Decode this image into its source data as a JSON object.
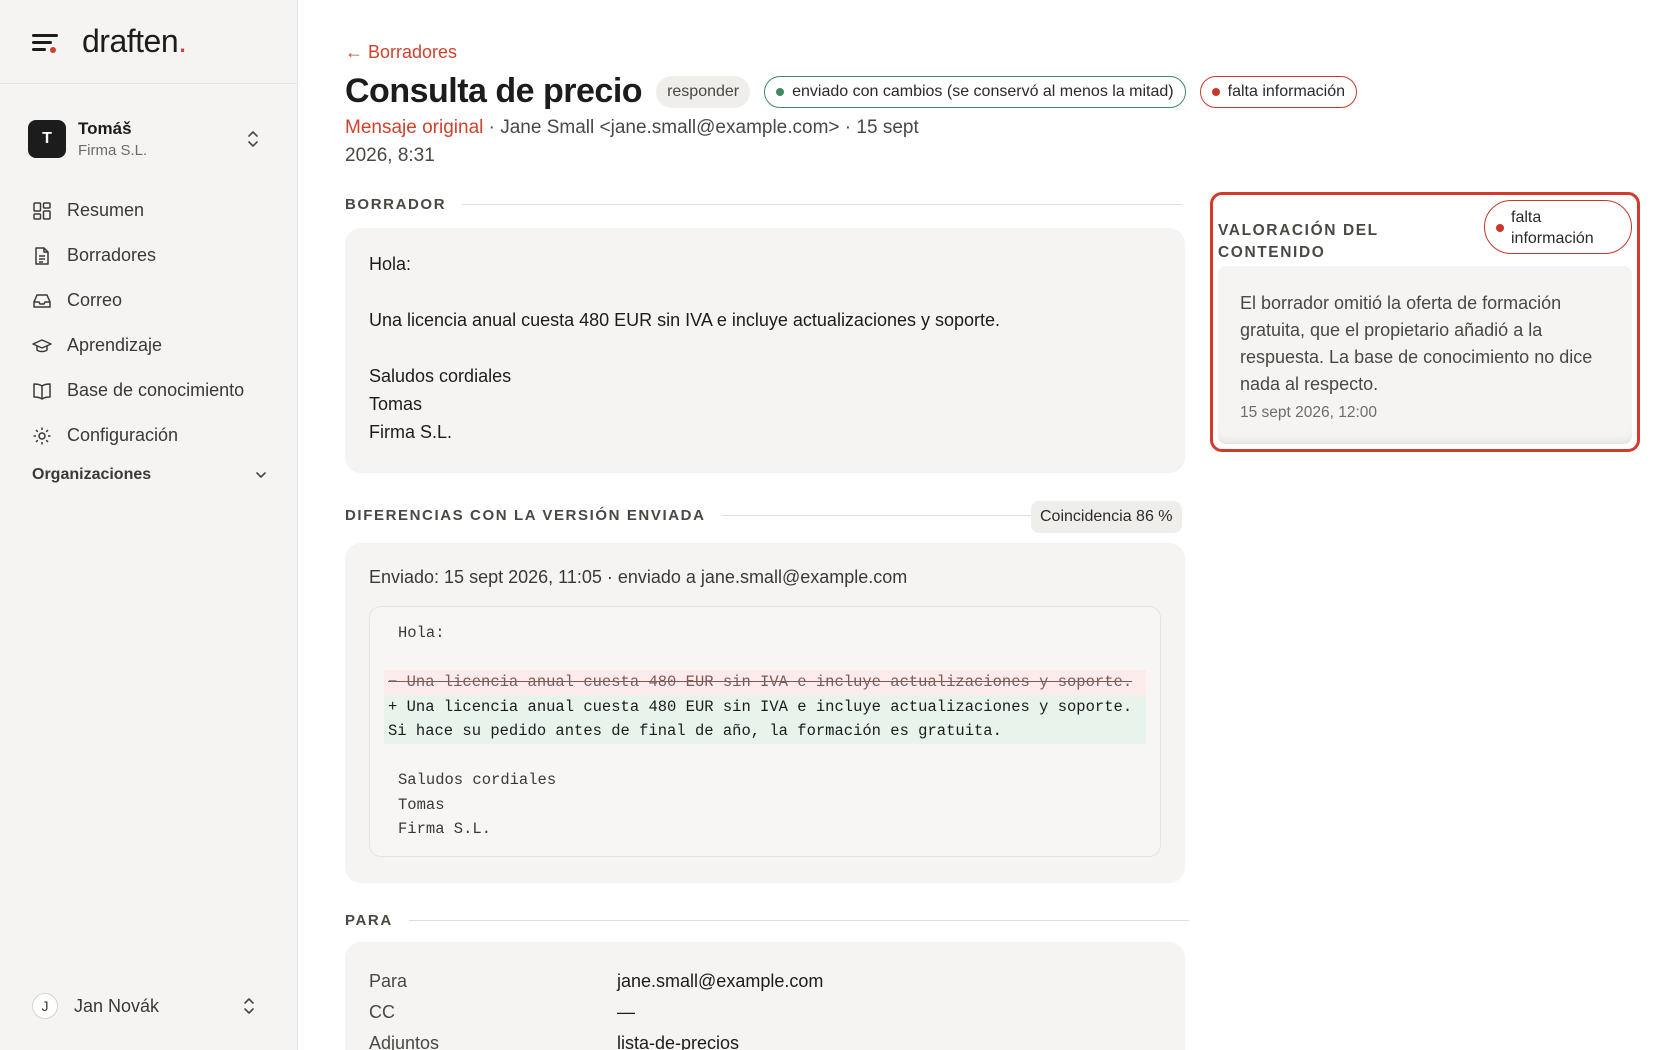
{
  "brand": {
    "name": "draften",
    "dot": "."
  },
  "account": {
    "initial": "T",
    "name": "Tomáš",
    "org": "Firma S.L."
  },
  "nav": [
    {
      "label": "Resumen",
      "icon": "dashboard-icon"
    },
    {
      "label": "Borradores",
      "icon": "document-icon"
    },
    {
      "label": "Correo",
      "icon": "inbox-icon"
    },
    {
      "label": "Aprendizaje",
      "icon": "graduation-cap-icon"
    },
    {
      "label": "Base de conocimiento",
      "icon": "book-icon"
    },
    {
      "label": "Configuración",
      "icon": "gear-icon"
    }
  ],
  "organizations_label": "Organizaciones",
  "user": {
    "initial": "J",
    "name": "Jan Novák"
  },
  "back_link": "← Borradores",
  "title": "Consulta de precio",
  "badges": {
    "type": "responder",
    "status": "enviado con cambios (se conservó al menos la mitad)",
    "flag": "falta información"
  },
  "subline": {
    "original": "Mensaje original",
    "rest": " · Jane Small <jane.small@example.com> · 15 sept 2026, 8:31"
  },
  "sections": {
    "draft": "BORRADOR",
    "diff": "DIFERENCIAS CON LA VERSIÓN ENVIADA",
    "to": "PARA"
  },
  "draft": {
    "greeting": "Hola:",
    "body": "Una licencia anual cuesta 480 EUR sin IVA e incluye actualizaciones y soporte.",
    "closing": "Saludos cordiales",
    "name": "Tomas",
    "company": "Firma S.L."
  },
  "match": "Coincidencia 86 %",
  "diff": {
    "sent_info": "Enviado: 15 sept 2026, 11:05 · enviado a jane.small@example.com",
    "ctx1": "Hola:",
    "removed": "− Una licencia anual cuesta 480 EUR sin IVA e incluye actualizaciones y soporte.",
    "added1": "+ Una licencia anual cuesta 480 EUR sin IVA e incluye actualizaciones y soporte.",
    "added2": "Si hace su pedido antes de final de año, la formación es gratuita.",
    "ctx2": "Saludos cordiales",
    "ctx3": "Tomas",
    "ctx4": "Firma S.L."
  },
  "to": {
    "rows": [
      {
        "k": "Para",
        "v": "jane.small@example.com"
      },
      {
        "k": "CC",
        "v": "—"
      },
      {
        "k": "Adjuntos",
        "v": "lista-de-precios"
      }
    ]
  },
  "assessment": {
    "label": "VALORACIÓN DEL CONTENIDO",
    "flag": "falta información",
    "text": "El borrador omitió la oferta de formación gratuita, que el propietario añadió a la respuesta. La base de conocimiento no dice nada al respecto.",
    "timestamp": "15 sept 2026, 12:00"
  },
  "colors": {
    "accent": "#d0412d",
    "success": "#3e8a63",
    "highlight_border": "#d43a2c"
  }
}
